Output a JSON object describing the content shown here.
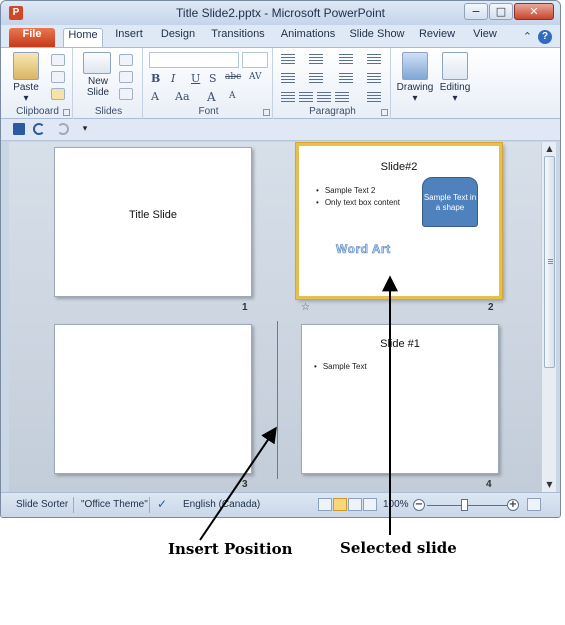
{
  "window": {
    "title": "Title Slide2.pptx  -  Microsoft PowerPoint",
    "app_icon_letter": "P",
    "buttons": {
      "minimize": "−",
      "maximize": "□",
      "close": "✕"
    }
  },
  "ribbon_tabs": [
    "File",
    "Home",
    "Insert",
    "Design",
    "Transitions",
    "Animations",
    "Slide Show",
    "Review",
    "View"
  ],
  "ribbon_tab_active": "Home",
  "help_symbol": "?",
  "collapse_symbol": "⌃",
  "ribbon": {
    "clipboard": {
      "paste_label": "Paste",
      "group_label": "Clipboard"
    },
    "slides": {
      "new_slide_label": "New Slide",
      "group_label": "Slides"
    },
    "font": {
      "group_label": "Font",
      "bold": "B",
      "italic": "I",
      "underline": "U",
      "strike": "S",
      "shadow": "abc",
      "spacing": "AV",
      "case": "Aa",
      "grow": "A",
      "shrink": "A",
      "color": "A"
    },
    "paragraph": {
      "group_label": "Paragraph"
    },
    "drawing": {
      "label": "Drawing"
    },
    "editing": {
      "label": "Editing"
    }
  },
  "slides": [
    {
      "number": "1",
      "title": "Title Slide",
      "selected": false
    },
    {
      "number": "2",
      "title": "Slide#2",
      "bullets": [
        "Sample Text 2",
        "Only text box content"
      ],
      "shape_text": "Sample Text in a shape",
      "word_art": "Word Art",
      "selected": true,
      "transition_symbol": "☆"
    },
    {
      "number": "3",
      "title": "",
      "selected": false
    },
    {
      "number": "4",
      "title": "Slide #1",
      "bullets": [
        "Sample Text"
      ],
      "selected": false
    }
  ],
  "statusbar": {
    "view": "Slide Sorter",
    "theme": "\"Office Theme\"",
    "language": "English (Canada)",
    "zoom": "100%",
    "zoom_minus": "−",
    "zoom_plus": "+",
    "zoom_level_percent": 100
  },
  "annotations": {
    "insert_position": "Insert Position",
    "selected_slide": "Selected slide"
  }
}
